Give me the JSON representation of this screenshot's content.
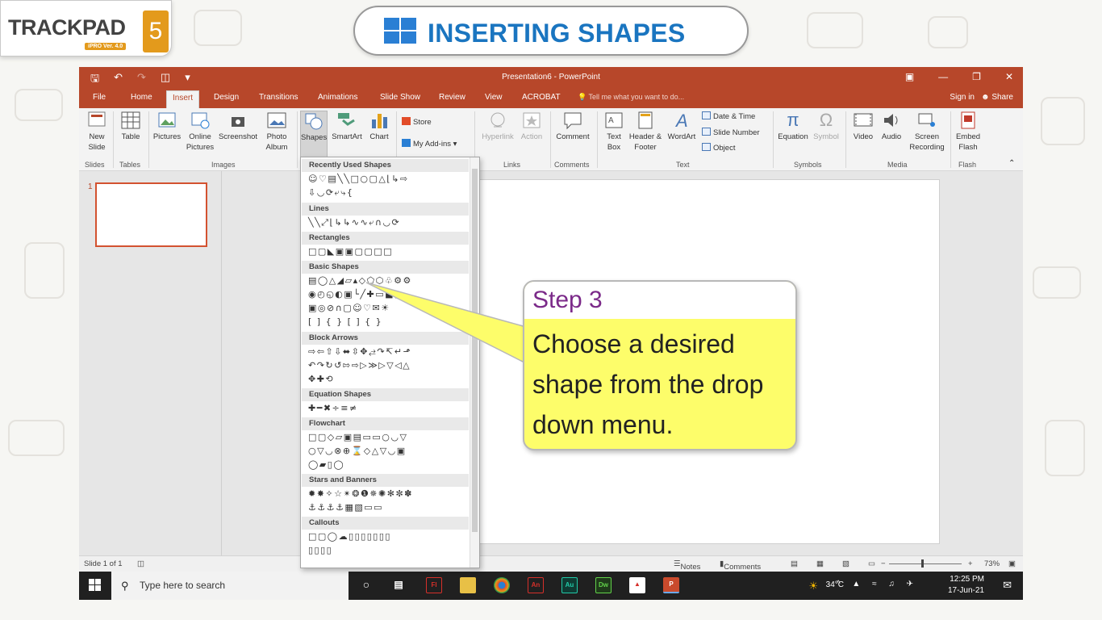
{
  "branding": {
    "logo_text": "TRACKPAD",
    "logo_version": "iPRO Ver. 4.0",
    "logo_number": "5",
    "banner_title": "INSERTING SHAPES"
  },
  "window": {
    "title": "Presentation6 - PowerPoint",
    "tabs": [
      "File",
      "Home",
      "Insert",
      "Design",
      "Transitions",
      "Animations",
      "Slide Show",
      "Review",
      "View",
      "ACROBAT"
    ],
    "active_tab": "Insert",
    "tell_me_placeholder": "Tell me what you want to do...",
    "sign_in": "Sign in",
    "share": "Share"
  },
  "ribbon": {
    "new_slide": "New Slide",
    "table": "Table",
    "pictures": "Pictures",
    "online_pictures": "Online Pictures",
    "screenshot": "Screenshot",
    "photo_album": "Photo Album",
    "shapes": "Shapes",
    "smartart": "SmartArt",
    "chart": "Chart",
    "store": "Store",
    "my_addins": "My Add-ins",
    "hyperlink": "Hyperlink",
    "action": "Action",
    "comment": "Comment",
    "text_box": "Text Box",
    "header_footer": "Header & Footer",
    "wordart": "WordArt",
    "date_time": "Date & Time",
    "slide_number": "Slide Number",
    "object": "Object",
    "equation": "Equation",
    "symbol": "Symbol",
    "video": "Video",
    "audio": "Audio",
    "screen_recording": "Screen Recording",
    "embed_flash": "Embed Flash",
    "groups": [
      "Slides",
      "Tables",
      "Images",
      "Links",
      "Comments",
      "Text",
      "Symbols",
      "Media",
      "Flash"
    ]
  },
  "shapes_menu": {
    "sections": [
      "Recently Used Shapes",
      "Lines",
      "Rectangles",
      "Basic Shapes",
      "Block Arrows",
      "Equation Shapes",
      "Flowchart",
      "Stars and Banners",
      "Callouts"
    ]
  },
  "thumbnails": {
    "slide_number": "1"
  },
  "callout": {
    "step": "Step 3",
    "text": "Choose a desired shape from the drop down menu."
  },
  "statusbar": {
    "slide_info": "Slide 1 of 1",
    "notes": "Notes",
    "comments": "Comments",
    "zoom": "73%"
  },
  "taskbar": {
    "search_placeholder": "Type here to search",
    "temperature": "34°C",
    "time": "12:25 PM",
    "date": "17-Jun-21"
  },
  "colors": {
    "ppt_accent": "#b7472a",
    "callout_fill": "#fdfd6a",
    "step_color": "#7b2a89",
    "banner_blue": "#1a75c0"
  }
}
